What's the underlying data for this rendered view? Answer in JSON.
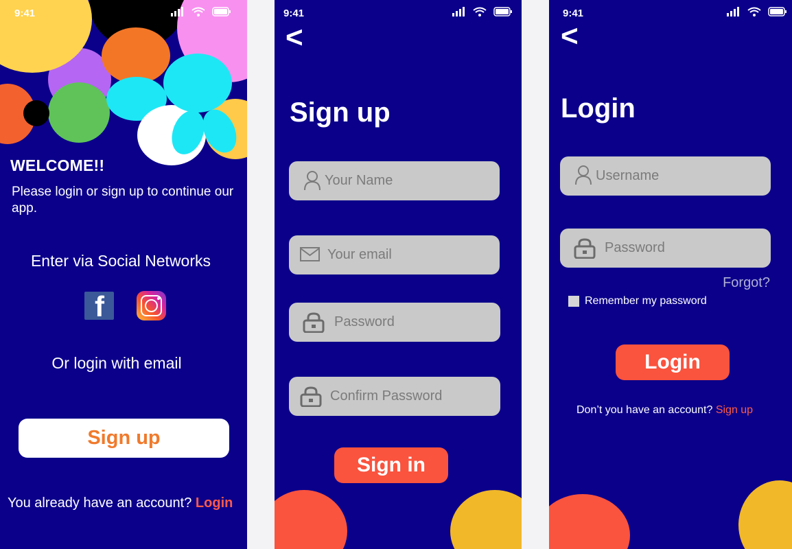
{
  "status": {
    "time": "9:41"
  },
  "welcome_screen": {
    "title": "WELCOME!!",
    "intro": "Please login or sign up to continue our app.",
    "social_title": "Enter via Social Networks",
    "social_icons": [
      "facebook-icon",
      "instagram-icon"
    ],
    "or_text": "Or login with email",
    "signup_button": "Sign up",
    "footer_text": "You already have an account?",
    "footer_link": "Login"
  },
  "signup_screen": {
    "back": "<",
    "title": "Sign up",
    "fields": [
      {
        "placeholder": "Your Name",
        "icon": "user-icon"
      },
      {
        "placeholder": "Your email",
        "icon": "mail-icon"
      },
      {
        "placeholder": "Password",
        "icon": "lock-icon"
      },
      {
        "placeholder": "Confirm Password",
        "icon": "lock-icon"
      }
    ],
    "submit_button": "Sign in"
  },
  "login_screen": {
    "back": "<",
    "title": "Login",
    "fields": [
      {
        "placeholder": "Username",
        "icon": "user-icon"
      },
      {
        "placeholder": "Password",
        "icon": "lock-icon"
      }
    ],
    "forgot": "Forgot?",
    "remember": "Remember my password",
    "submit_button": "Login",
    "footer_text": "Don’t you have an account?",
    "footer_link": "Sign up"
  },
  "colors": {
    "background": "#0b008a",
    "accent_red": "#fa533e",
    "accent_orange": "#f07a2c",
    "accent_yellow": "#f1b82a",
    "field": "#c9c9c9"
  }
}
